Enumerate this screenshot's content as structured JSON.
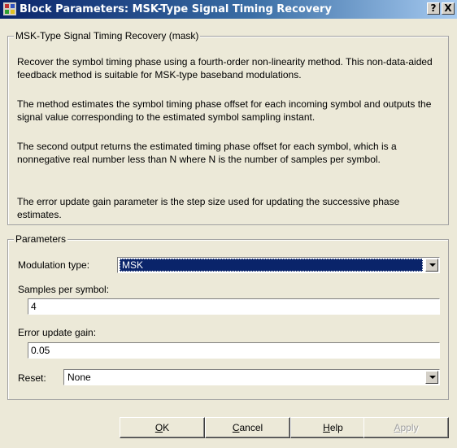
{
  "window": {
    "title": "Block Parameters: MSK-Type Signal Timing Recovery",
    "help_button": "?",
    "close_button": "X"
  },
  "mask": {
    "legend": "MSK-Type Signal Timing Recovery (mask)",
    "paragraphs": [
      "Recover the symbol timing phase using a fourth-order non-linearity method. This non-data-aided feedback method is suitable for MSK-type baseband modulations.",
      "The method estimates the symbol timing phase offset for each incoming symbol and outputs the signal value corresponding to the estimated symbol sampling instant.",
      "The second output returns the estimated timing phase offset for each symbol, which is a nonnegative real number less than N where N is the number of samples per symbol.",
      "The error update gain parameter is the step size used for updating the successive phase estimates."
    ]
  },
  "parameters": {
    "legend": "Parameters",
    "modulation_type": {
      "label": "Modulation type:",
      "value": "MSK"
    },
    "samples_per_symbol": {
      "label": "Samples per symbol:",
      "value": "4"
    },
    "error_update_gain": {
      "label": "Error update gain:",
      "value": "0.05"
    },
    "reset": {
      "label": "Reset:",
      "value": "None"
    }
  },
  "buttons": {
    "ok": {
      "accel": "O",
      "rest": "K"
    },
    "cancel": {
      "accel": "C",
      "rest": "ancel"
    },
    "help": {
      "accel": "H",
      "rest": "elp"
    },
    "apply": {
      "accel": "A",
      "rest": "pply"
    }
  }
}
